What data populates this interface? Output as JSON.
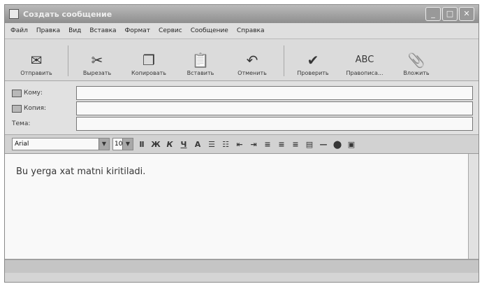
{
  "window": {
    "title": "Создать сообщение"
  },
  "menu": [
    "Файл",
    "Правка",
    "Вид",
    "Вставка",
    "Формат",
    "Сервис",
    "Сообщение",
    "Справка"
  ],
  "toolbar": [
    {
      "label": "Отправить",
      "icon": "send-icon"
    },
    {
      "label": "Вырезать",
      "icon": "cut-icon"
    },
    {
      "label": "Копировать",
      "icon": "copy-icon"
    },
    {
      "label": "Вставить",
      "icon": "paste-icon"
    },
    {
      "label": "Отменить",
      "icon": "undo-icon"
    },
    {
      "label": "Проверить",
      "icon": "check-names-icon"
    },
    {
      "label": "Правописа...",
      "icon": "spelling-icon"
    },
    {
      "label": "Вложить",
      "icon": "attach-icon"
    }
  ],
  "fields": {
    "to_label": "Кому:",
    "cc_label": "Копия:",
    "subject_label": "Тема:",
    "to_value": "",
    "cc_value": "",
    "subject_value": ""
  },
  "format": {
    "font": "Arial",
    "size": "10"
  },
  "body_text": "Bu yerga xat matni kiritiladi."
}
